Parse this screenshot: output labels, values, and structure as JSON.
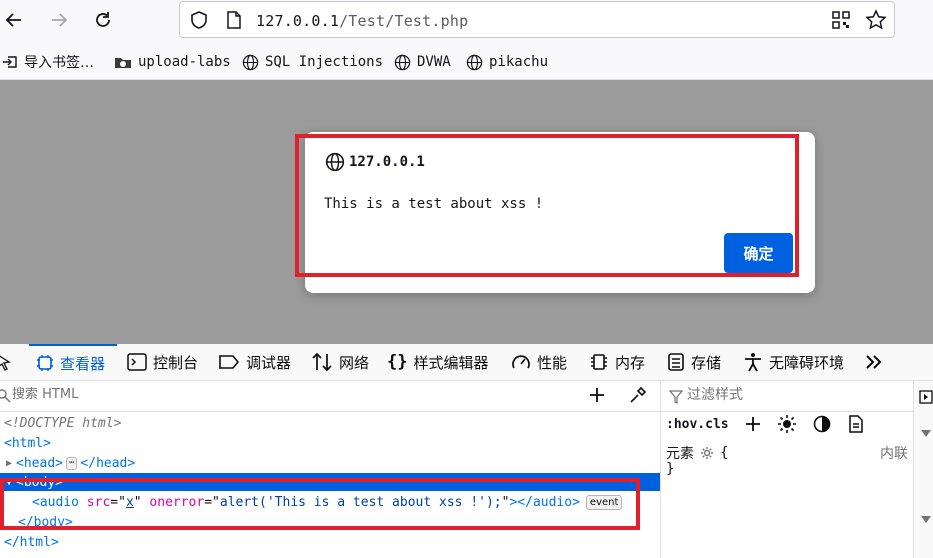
{
  "toolbar": {
    "url_host": "127.0.0.1",
    "url_path": "/Test/Test.php"
  },
  "bookmarks": [
    {
      "label": "导入书签…",
      "icon": "import-icon"
    },
    {
      "label": "upload-labs",
      "icon": "folder-icon"
    },
    {
      "label": "SQL Injections",
      "icon": "globe-icon"
    },
    {
      "label": "DVWA",
      "icon": "globe-icon"
    },
    {
      "label": "pikachu",
      "icon": "globe-icon"
    }
  ],
  "dialog": {
    "origin": "127.0.0.1",
    "message": "This is a test about xss !",
    "ok_label": "确定"
  },
  "devtools": {
    "tabs": [
      {
        "label": "查看器",
        "icon": "inspector-icon",
        "active": true
      },
      {
        "label": "控制台",
        "icon": "console-icon"
      },
      {
        "label": "调试器",
        "icon": "debugger-icon"
      },
      {
        "label": "网络",
        "icon": "network-icon"
      },
      {
        "label": "样式编辑器",
        "icon": "style-editor-icon"
      },
      {
        "label": "性能",
        "icon": "performance-icon"
      },
      {
        "label": "内存",
        "icon": "memory-icon"
      },
      {
        "label": "存储",
        "icon": "storage-icon"
      },
      {
        "label": "无障碍环境",
        "icon": "accessibility-icon"
      }
    ],
    "search_placeholder": "搜索 HTML",
    "tree": {
      "doctype": "<!DOCTYPE html>",
      "html_open": "<html>",
      "head_open": "<head>",
      "head_close": "</head>",
      "body_open": "<body>",
      "audio_tag_open": "<audio",
      "audio_src_name": "src",
      "audio_src_value": "x",
      "audio_onerror_name": "onerror",
      "audio_onerror_value": "alert('This is a test about xss !');",
      "audio_tag_close": "></audio>",
      "event_badge": "event",
      "body_close": "</body>",
      "html_close": "</html>"
    },
    "styles": {
      "filter_placeholder": "过滤样式",
      "hov_cls": ":hov.cls",
      "element_label": "元素",
      "open_brace": "{",
      "close_brace": "}",
      "inline_label": "内联"
    }
  },
  "colors": {
    "accent": "#0061e0",
    "highlight": "#e0202a",
    "page_overlay": "#9b9b9b"
  }
}
